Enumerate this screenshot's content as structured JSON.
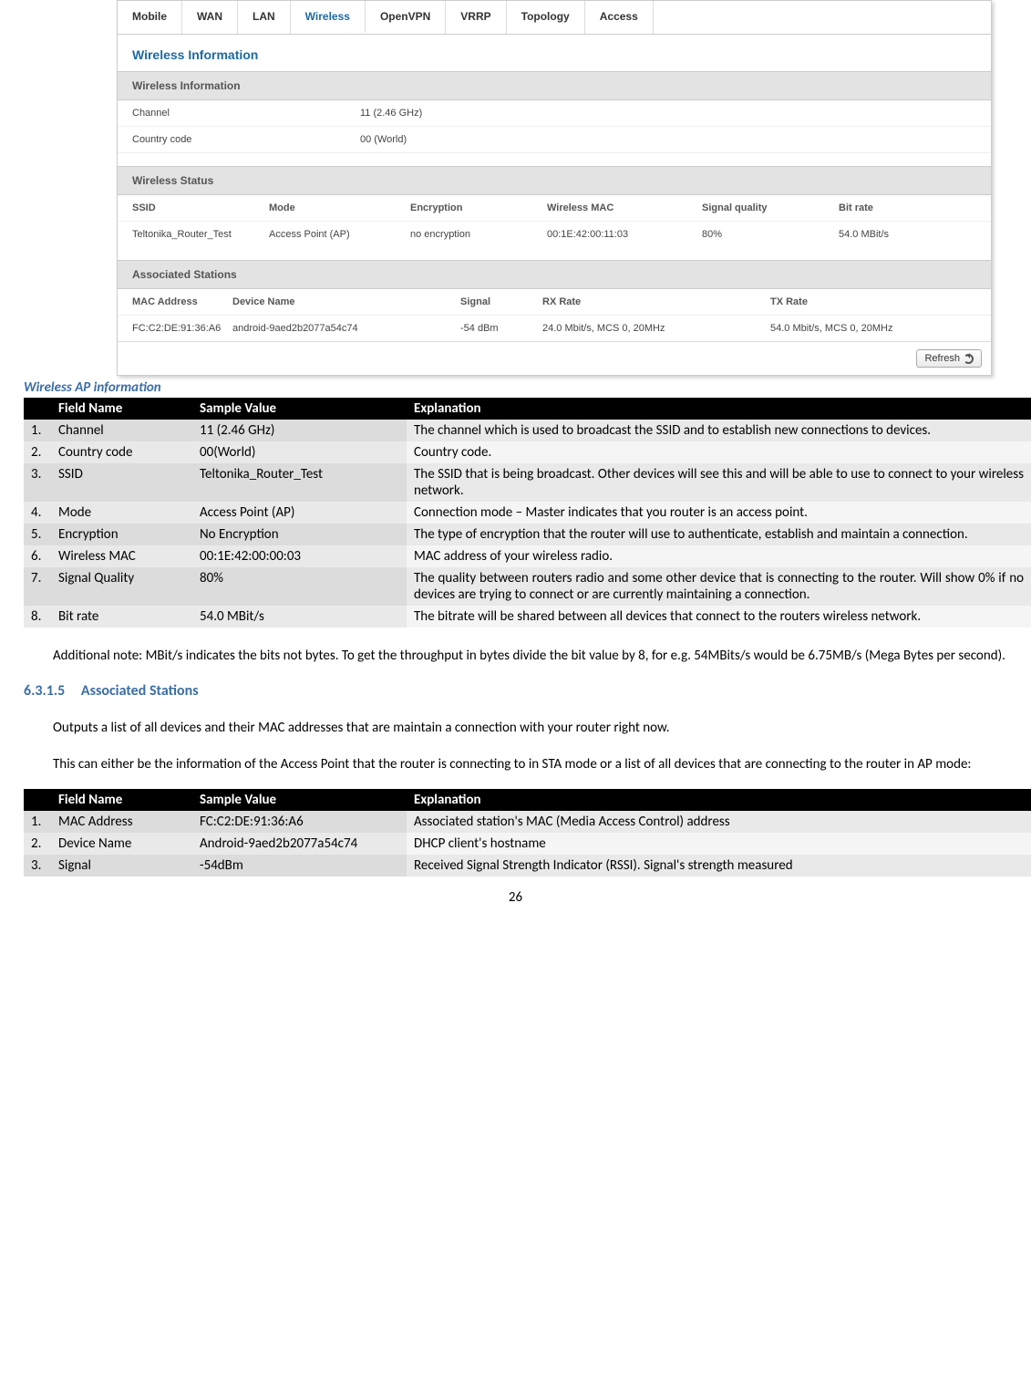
{
  "screenshot": {
    "tabs": [
      "Mobile",
      "WAN",
      "LAN",
      "Wireless",
      "OpenVPN",
      "VRRP",
      "Topology",
      "Access"
    ],
    "active_tab_index": 3,
    "panel_title": "Wireless Information",
    "section1_title": "Wireless Information",
    "info": {
      "channel_label": "Channel",
      "channel_value": "11 (2.46 GHz)",
      "country_label": "Country code",
      "country_value": "00 (World)"
    },
    "section2_title": "Wireless Status",
    "status_headers": [
      "SSID",
      "Mode",
      "Encryption",
      "Wireless MAC",
      "Signal quality",
      "Bit rate"
    ],
    "status_row": [
      "Teltonika_Router_Test",
      "Access Point (AP)",
      "no encryption",
      "00:1E:42:00:11:03",
      "80%",
      "54.0 MBit/s"
    ],
    "section3_title": "Associated Stations",
    "assoc_headers": [
      "MAC Address",
      "Device Name",
      "Signal",
      "RX Rate",
      "TX Rate"
    ],
    "assoc_row": [
      "FC:C2:DE:91:36:A6",
      "android-9aed2b2077a54c74",
      "-54 dBm",
      "24.0 Mbit/s, MCS 0, 20MHz",
      "54.0 Mbit/s, MCS 0, 20MHz"
    ],
    "refresh_label": "Refresh"
  },
  "caption": "Wireless AP information",
  "table1": {
    "headers": [
      "",
      "Field Name",
      "Sample Value",
      "Explanation"
    ],
    "rows": [
      [
        "1.",
        "Channel",
        "11 (2.46 GHz)",
        "The channel which is used to broadcast the SSID and to establish new connections to devices."
      ],
      [
        "2.",
        "Country code",
        "00(World)",
        "Country code."
      ],
      [
        "3.",
        "SSID",
        "Teltonika_Router_Test",
        "The SSID that is being broadcast. Other devices will see this and will be able to use to connect to your wireless network."
      ],
      [
        "4.",
        "Mode",
        "Access Point (AP)",
        "Connection mode – Master indicates that you router is an access point."
      ],
      [
        "5.",
        "Encryption",
        "No Encryption",
        "The type of encryption that the router will use to authenticate, establish and maintain a connection."
      ],
      [
        "6.",
        "Wireless MAC",
        "00:1E:42:00:00:03",
        "MAC address of your wireless radio."
      ],
      [
        "7.",
        "Signal Quality",
        "80%",
        "The quality between routers radio and some other device that is connecting to the router. Will show 0% if no devices are trying to connect or are currently maintaining a connection."
      ],
      [
        "8.",
        "Bit rate",
        "54.0 MBit/s",
        "The bitrate will be shared between all devices that connect to the routers wireless network."
      ]
    ]
  },
  "note_para": "Additional note: MBit/s indicates the bits not bytes. To get the throughput in bytes divide the bit value by 8, for e.g. 54MBits/s would be 6.75MB/s (Mega Bytes per second).",
  "heading": {
    "num": "6.3.1.5",
    "text": "Associated Stations"
  },
  "para2": "Outputs a list of all devices and their MAC addresses that are maintain a connection with your router right now.",
  "para3": "This can either be the information of the Access Point that the router is connecting to in STA mode or a list of all devices that are connecting to the router in AP mode:",
  "table2": {
    "headers": [
      "",
      "Field Name",
      "Sample Value",
      "Explanation"
    ],
    "rows": [
      [
        "1.",
        "MAC Address",
        "FC:C2:DE:91:36:A6",
        "Associated station's MAC (Media Access Control) address"
      ],
      [
        "2.",
        "Device Name",
        "Android-9aed2b2077a54c74",
        "DHCP client's hostname"
      ],
      [
        "3.",
        "Signal",
        "-54dBm",
        "Received Signal Strength Indicator (RSSI). Signal's strength measured"
      ]
    ]
  },
  "page_number": "26"
}
